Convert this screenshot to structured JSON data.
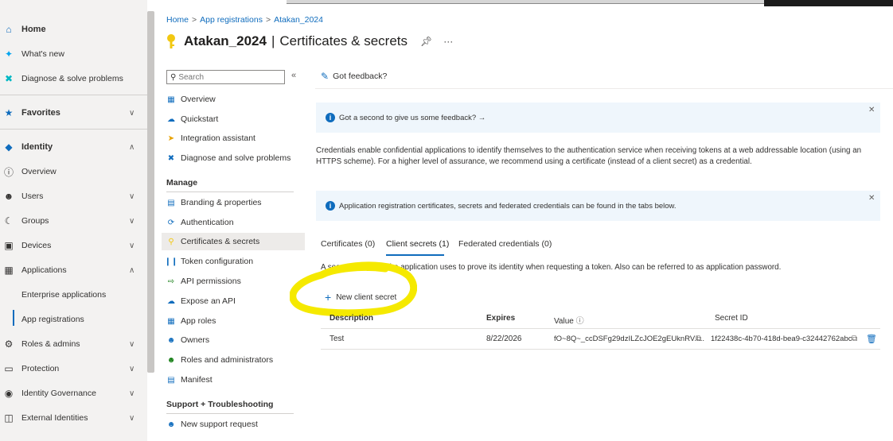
{
  "breadcrumb": [
    "Home",
    "App registrations",
    "Atakan_2024"
  ],
  "title": {
    "app_name": "Atakan_2024",
    "separator": "|",
    "page": "Certificates & secrets"
  },
  "left_nav": {
    "home": "Home",
    "whats_new": "What's new",
    "diagnose": "Diagnose & solve problems",
    "favorites": "Favorites",
    "identity": "Identity",
    "overview": "Overview",
    "users": "Users",
    "groups": "Groups",
    "devices": "Devices",
    "applications": "Applications",
    "enterprise_apps": "Enterprise applications",
    "app_registrations": "App registrations",
    "roles_admins": "Roles & admins",
    "protection": "Protection",
    "identity_governance": "Identity Governance",
    "external_identities": "External Identities"
  },
  "menu": {
    "search_placeholder": "Search",
    "overview": "Overview",
    "quickstart": "Quickstart",
    "integration_assistant": "Integration assistant",
    "diagnose": "Diagnose and solve problems",
    "manage_header": "Manage",
    "branding": "Branding & properties",
    "authentication": "Authentication",
    "certificates": "Certificates & secrets",
    "token_config": "Token configuration",
    "api_permissions": "API permissions",
    "expose_api": "Expose an API",
    "app_roles": "App roles",
    "owners": "Owners",
    "roles_admins": "Roles and administrators",
    "manifest": "Manifest",
    "support_header": "Support + Troubleshooting",
    "new_support": "New support request"
  },
  "content": {
    "feedback": "Got feedback?",
    "info1": "Got a second to give us some feedback? →",
    "description": "Credentials enable confidential applications to identify themselves to the authentication service when receiving tokens at a web addressable location (using an HTTPS scheme). For a higher level of assurance, we recommend using a certificate (instead of a client secret) as a credential.",
    "info2": "Application registration certificates, secrets and federated credentials can be found in the tabs below.",
    "tabs": [
      "Certificates (0)",
      "Client secrets (1)",
      "Federated credentials (0)"
    ],
    "secret_desc": "A secret string that the application uses to prove its identity when requesting a token. Also can be referred to as application password.",
    "new_secret": "New client secret",
    "table": {
      "headers": [
        "Description",
        "Expires",
        "Value",
        "Secret ID"
      ],
      "row": {
        "description": "Test",
        "expires": "8/22/2026",
        "value": "fO~8Q~_ccDSFg29dzILZcJOE2gEUknRV.l...",
        "secret_id": "1f22438c-4b70-418d-bea9-c32442762abc"
      }
    }
  },
  "colors": {
    "accent": "#0f6cbd",
    "highlight": "#f5e900",
    "info_bg": "#eff6fc"
  }
}
